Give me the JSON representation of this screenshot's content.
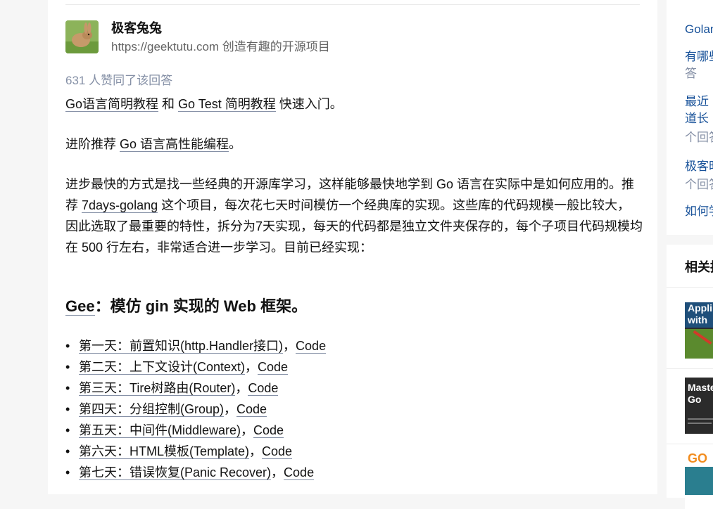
{
  "author": {
    "name": "极客兔兔",
    "bio": "https://geektutu.com 创造有趣的开源项目"
  },
  "votes": "631 人赞同了该回答",
  "p1": {
    "link1": "Go语言简明教程",
    "sep": " 和 ",
    "link2": "Go Test 简明教程",
    "tail": " 快速入门。"
  },
  "p2": {
    "lead": "进阶推荐 ",
    "link": "Go 语言高性能编程",
    "tail": "。"
  },
  "p3": {
    "lead": "进步最快的方式是找一些经典的开源库学习，这样能够最快地学到 Go 语言在实际中是如何应用的。推荐 ",
    "link": "7days-golang",
    "tail": " 这个项目，每次花七天时间模仿一个经典库的实现。这些库的代码规模一般比较大，因此选取了最重要的特性，拆分为7天实现，每天的代码都是独立文件夹保存的，每个子项目代码规模均在 500 行左右，非常适合进一步学习。目前已经实现："
  },
  "heading": "Gee：模仿 gin 实现的 Web 框架。",
  "bullet": "•",
  "code_label": "Code",
  "days": [
    {
      "title": "第一天：前置知识(http.Handler接口)",
      "sep": "，",
      "code": "Code"
    },
    {
      "title": "第二天：上下文设计(Context)",
      "sep": "，",
      "code": "Code"
    },
    {
      "title": "第三天：Tire树路由(Router)",
      "sep": "，",
      "code": "Code"
    },
    {
      "title": "第四天：分组控制(Group)",
      "sep": "，",
      "code": "Code"
    },
    {
      "title": "第五天：中间件(Middleware)",
      "sep": "，",
      "code": "Code"
    },
    {
      "title": "第六天：HTML模板(Template)",
      "sep": "，",
      "code": "Code"
    },
    {
      "title": "第七天：错误恢复(Panic Recover)",
      "sep": "，",
      "code": "Code"
    }
  ],
  "sidebar": {
    "links": [
      "Golan",
      "有哪些",
      "答",
      "最近",
      "道长",
      "个回答",
      "极客时",
      "个回答",
      "如何学"
    ],
    "related_title": "相关推",
    "books": [
      "Appli with",
      "Maste Go",
      "GO"
    ]
  },
  "colors": {
    "link_underline": "#8590a6",
    "side_link": "#175199",
    "meta": "#8590a6"
  }
}
